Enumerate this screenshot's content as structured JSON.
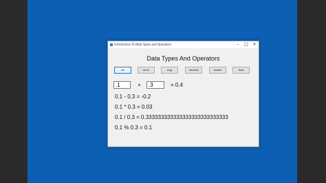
{
  "window": {
    "title": "Introduction To Data Types and Operators",
    "min_glyph": "–",
    "max_glyph": "□",
    "close_glyph": "✕"
  },
  "heading": "Data Types And Operators",
  "type_buttons": [
    {
      "label": "int",
      "selected": true
    },
    {
      "label": "short",
      "selected": false
    },
    {
      "label": "long",
      "selected": false
    },
    {
      "label": "decimal",
      "selected": false
    },
    {
      "label": "double",
      "selected": false
    },
    {
      "label": "float",
      "selected": false
    }
  ],
  "inputs": {
    "operand1": ".1",
    "operator": "+",
    "operand2": ".3",
    "result": "= 0.4"
  },
  "results": [
    "0.1 - 0.3 = -0.2",
    "0.1 * 0.3 = 0.03",
    "0.1 / 0.3 = 0.333333333333333333333333333",
    "0.1 % 0.3 = 0.1"
  ],
  "colors": {
    "desktop": "#0d5fb3",
    "letterbox": "#2a2a2a",
    "window_bg": "#f0f0f0"
  }
}
